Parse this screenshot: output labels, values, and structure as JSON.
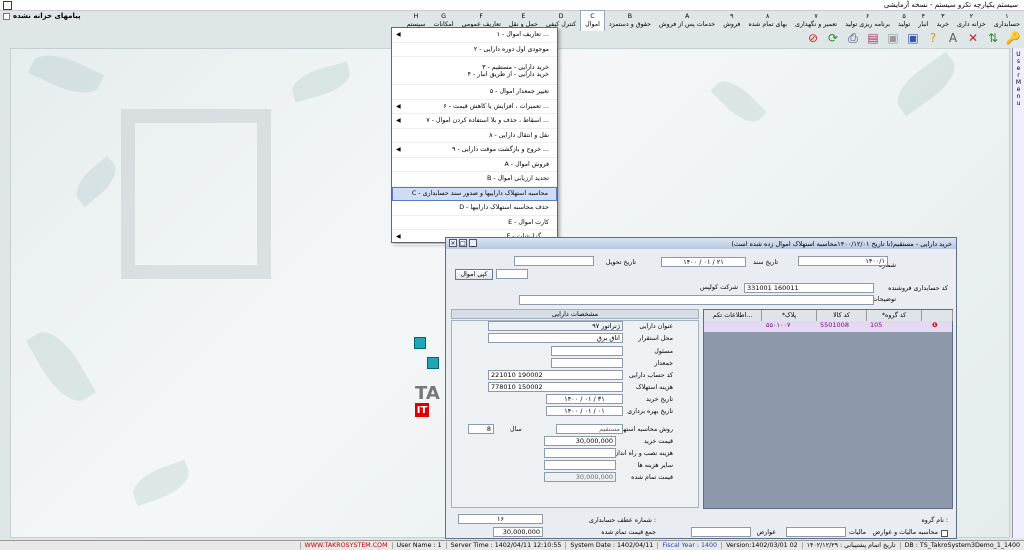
{
  "app": {
    "title": "سیستم یکپارچه تکرو سیستم - نسخه آزمایشی",
    "notice": "پیامهای خزانه نشده"
  },
  "menu": [
    {
      "key": "۱",
      "label": "حسابداری"
    },
    {
      "key": "۲",
      "label": "خزانه داری"
    },
    {
      "key": "۳",
      "label": "خرید"
    },
    {
      "key": "۴",
      "label": "انبار"
    },
    {
      "key": "۵",
      "label": "تولید"
    },
    {
      "key": "۶",
      "label": "برنامه ریزی تولید"
    },
    {
      "key": "۷",
      "label": "تعمیر و نگهداری"
    },
    {
      "key": "۸",
      "label": "بهای تمام شده"
    },
    {
      "key": "۹",
      "label": "فروش"
    },
    {
      "key": "A",
      "label": "خدمات پس از فروش"
    },
    {
      "key": "B",
      "label": "حقوق و دستمزد"
    },
    {
      "key": "C",
      "label": "اموال"
    },
    {
      "key": "D",
      "label": "کنترل کیفی"
    },
    {
      "key": "E",
      "label": "حمل و نقل"
    },
    {
      "key": "F",
      "label": "تعاریف عمومی"
    },
    {
      "key": "G",
      "label": "امکانات"
    },
    {
      "key": "H",
      "label": "سیستم"
    }
  ],
  "toolbar": [
    {
      "icon": "key-icon",
      "glyph": "🔑",
      "color": "#d08a10"
    },
    {
      "icon": "arrows-icon",
      "glyph": "⇅",
      "color": "#2a8a2a"
    },
    {
      "icon": "close-icon",
      "glyph": "✕",
      "color": "#c22"
    },
    {
      "icon": "font-icon",
      "glyph": "A",
      "color": "#555"
    },
    {
      "icon": "help-icon",
      "glyph": "?",
      "color": "#d0a000"
    },
    {
      "icon": "save-icon",
      "glyph": "▣",
      "color": "#3355aa"
    },
    {
      "icon": "save-disabled-icon",
      "glyph": "▣",
      "color": "#999"
    },
    {
      "icon": "report-icon",
      "glyph": "▤",
      "color": "#aa3366"
    },
    {
      "icon": "print-icon",
      "glyph": "⎙",
      "color": "#334466"
    },
    {
      "icon": "refresh-icon",
      "glyph": "⟳",
      "color": "#2a8a2a"
    },
    {
      "icon": "cancel-icon",
      "glyph": "⊘",
      "color": "#c22"
    }
  ],
  "dropdown": [
    {
      "label": "۱ - تعاریف اموال ...",
      "sub": true
    },
    {
      "label": "۲ - موجودی اول دوره دارایی",
      "sub": false
    },
    {
      "label": "۳ - خرید دارایی - مستقیم\n۴ - خرید دارایی - از طریق انبار",
      "sub": false,
      "double": true
    },
    {
      "label": "۵ - تغییر جمعدار اموال",
      "sub": false
    },
    {
      "label": "۶ - تعمیرات ، افزایش یا کاهش قیمت ...",
      "sub": true
    },
    {
      "label": "۷ - اسقاط ، حذف و بلا استفاده کردن اموال ...",
      "sub": true
    },
    {
      "label": "۸ - نقل و انتقال دارایی",
      "sub": false
    },
    {
      "label": "۹ - خروج و بازگشت موقت دارایی ...",
      "sub": true
    },
    {
      "label": "A - فروش اموال",
      "sub": false
    },
    {
      "label": "B - تجدید ارزیابی اموال",
      "sub": false
    },
    {
      "label": "C - محاسبه استهلاک داراییها و صدور سند حسابداری",
      "sub": false,
      "selected": true
    },
    {
      "label": "D - حذف محاسبه استهلاک داراییها",
      "sub": false
    },
    {
      "label": "E - کارت اموال",
      "sub": false
    },
    {
      "label": "F - گزارشات ...",
      "sub": true
    }
  ],
  "form": {
    "title": "خرید دارایی - مستقیم(تا تاریخ ۱۴۰۰/۱۲/۰۱محاسبه استهلاک اموال زده شده است)",
    "number_label": "شماره",
    "number_value": "۱۴۰۰/۱",
    "doc_date_label": "تاریخ سند",
    "doc_date_value": "۱۴۰۰ / ۰۱ / ۲۱",
    "delivery_date_label": "تاریخ تحویل",
    "delivery_date_value": "",
    "copy_button": "کپی اموال",
    "supplier_label": "کد حسابداری فروشنده",
    "supplier_code": "331001 160011",
    "supplier_name": "شرکت کولپس",
    "desc_label": "توضیحات",
    "grid_headers": [
      "*کد گروه",
      "کد کالا",
      "*پلاک",
      "اطلاعات تکم..."
    ],
    "grid_row": {
      "group": "105",
      "item": "5501008",
      "tag": "۵۵۰۱۰۰۷"
    },
    "specs_header": "مشخصات دارایی",
    "title_label": "عنوان دارایی",
    "title_value": "ژنراتور ۹۷",
    "place_label": "محل استقرار",
    "place_value": "اتاق برق",
    "owner_label": "مسئول",
    "owner_value": "",
    "keeper_label": "جمعدار",
    "keeper_value": "",
    "acct_label": "کد حساب دارایی",
    "acct_value": "221010 190002",
    "dep_cost_label": "هزینه استهلاک",
    "dep_cost_value": "778010 150002",
    "buy_date_label": "تاریخ خرید",
    "buy_date_value": "۱۴۰۰ / ۰۱ / ۳۱",
    "use_date_label": "تاریخ بهره برداری",
    "use_date_value": "۱۴۰۰ / ۰۱ / ۰۱",
    "dep_method_label": "روش محاسبه استهلاک",
    "dep_method_value": "مستقیم",
    "years_label": "سال",
    "years_value": "8",
    "price_label": "قیمت خرید",
    "price_value": "30,000,000",
    "install_label": "هزینه نصب و راه اندازی",
    "install_value": "",
    "other_label": "سایر هزینه ها",
    "other_value": "",
    "final_label": "قیمت تمام شده",
    "final_value": "30,000,000",
    "group_name_label": "نام گروه :",
    "ref_label": "شماره عطف حسابداری :",
    "ref_value": "۱۶",
    "total_label": "جمع قیمت تمام شده",
    "total_value": "30,000,000",
    "tax_check_label": "محاسبه مالیات و عوارض",
    "tax_label": "مالیات",
    "duty_label": "عوارض"
  },
  "status": [
    "DB : TS_TakroSystem3Demo_1_1400",
    "تاریخ اتمام پشتیبانی : ۱۴۰۲/۱۲/۲۹",
    "Version:1402/03/01  02",
    "Fiscal Year : 1400",
    "System Date : 1402/04/11",
    "Server Time : 1402/04/11 12:10:55",
    "User Name : 1",
    "WWW.TAKROSYSTEM.COM"
  ],
  "side_letters": [
    "U",
    "s",
    "e",
    "r",
    "M",
    "e",
    "n",
    "u"
  ],
  "brand": "TA"
}
